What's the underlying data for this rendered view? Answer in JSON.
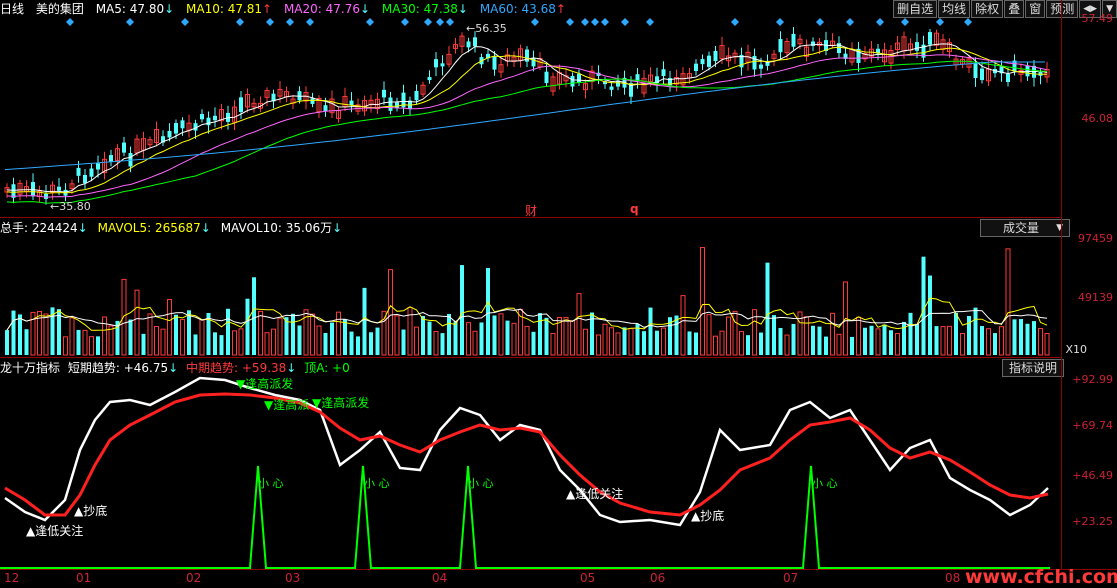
{
  "main_header": {
    "period": "日线",
    "stock_name": "美的集团",
    "ma5": "MA5: 47.80",
    "ma10": "MA10: 47.81",
    "ma20": "MA20: 47.76",
    "ma30": "MA30: 47.38",
    "ma60": "MA60: 43.68",
    "arrow_down": "↓",
    "arrow_up": "↑"
  },
  "toolbar": {
    "remove_watch": "删自选",
    "ma_lines": "均线",
    "adjust": "除权",
    "overlay": "叠",
    "window": "窗",
    "forecast": "预测",
    "collapse": "◀▶",
    "dropdown": "▼"
  },
  "price_axis": [
    "57.49",
    "46.08"
  ],
  "price_annotations": {
    "high": "56.35",
    "low": "35.80",
    "fin": "财",
    "q": "q"
  },
  "volume_header": {
    "total": "总手: 224424",
    "mavol5": "MAVOL5: 265687",
    "mavol10": "MAVOL10: 35.06万",
    "selector": "成交量"
  },
  "volume_axis": [
    "97459",
    "49139",
    "X10"
  ],
  "indicator_header": {
    "name": "龙十万指标",
    "short": "短期趋势: +46.75",
    "mid": "中期趋势: +59.38",
    "top": "顶A: +0",
    "explain": "指标说明"
  },
  "indicator_axis": [
    "+92.99",
    "+69.74",
    "+46.49",
    "+23.25"
  ],
  "indicator_labels": {
    "escape1": "逢高派发",
    "escape2": "逢高派",
    "escape3": "逢高派发",
    "bottom1": "抄底",
    "attention1": "逢低关注",
    "attention2": "逢低关注",
    "bottom2": "抄底",
    "careful": "小 心"
  },
  "months": [
    "12",
    "01",
    "02",
    "03",
    "04",
    "05",
    "06",
    "07",
    "08"
  ],
  "watermark": "www.cfchi.com",
  "colors": {
    "up": "#ff3a3a",
    "down": "#54ffff",
    "ma5": "#ffffff",
    "ma10": "#ffff00",
    "ma20": "#ff66ff",
    "ma30": "#00ff00",
    "ma60": "#2fa8ff"
  }
}
